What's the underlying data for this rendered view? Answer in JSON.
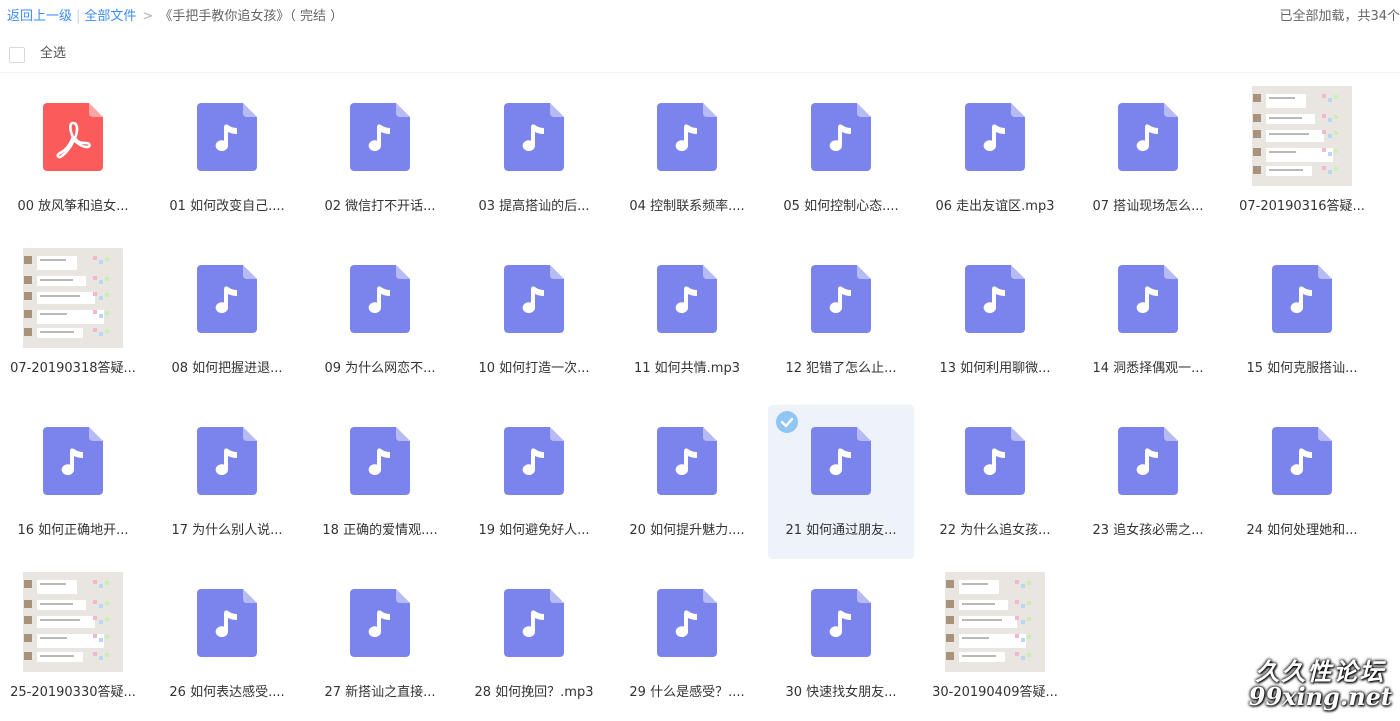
{
  "header": {
    "back_label": "返回上一级",
    "all_files_label": "全部文件",
    "current_folder": "《手把手教你追女孩》（ 完结 ）",
    "loaded_status": "已全部加载，共34个"
  },
  "select_all_label": "全选",
  "colors": {
    "audio_icon": "#7b83ec",
    "pdf_icon": "#fb5b5b",
    "link": "#3b8cff",
    "selected_bg": "#eef3fa"
  },
  "files": [
    {
      "name": "00 放风筝和追女...",
      "type": "pdf"
    },
    {
      "name": "01 如何改变自己....",
      "type": "audio"
    },
    {
      "name": "02 微信打不开话...",
      "type": "audio"
    },
    {
      "name": "03 提高搭讪的后...",
      "type": "audio"
    },
    {
      "name": "04 控制联系频率....",
      "type": "audio"
    },
    {
      "name": "05 如何控制心态....",
      "type": "audio"
    },
    {
      "name": "06 走出友谊区.mp3",
      "type": "audio"
    },
    {
      "name": "07 搭讪现场怎么...",
      "type": "audio"
    },
    {
      "name": "07-20190316答疑...",
      "type": "image"
    },
    {
      "name": "07-20190318答疑...",
      "type": "image"
    },
    {
      "name": "08 如何把握进退...",
      "type": "audio"
    },
    {
      "name": "09 为什么网恋不...",
      "type": "audio"
    },
    {
      "name": "10 如何打造一次...",
      "type": "audio"
    },
    {
      "name": "11 如何共情.mp3",
      "type": "audio"
    },
    {
      "name": "12 犯错了怎么止...",
      "type": "audio"
    },
    {
      "name": "13 如何利用聊微...",
      "type": "audio"
    },
    {
      "name": "14 洞悉择偶观一...",
      "type": "audio"
    },
    {
      "name": "15 如何克服搭讪...",
      "type": "audio"
    },
    {
      "name": "16 如何正确地开...",
      "type": "audio"
    },
    {
      "name": "17 为什么别人说...",
      "type": "audio"
    },
    {
      "name": "18 正确的爱情观....",
      "type": "audio"
    },
    {
      "name": "19 如何避免好人...",
      "type": "audio"
    },
    {
      "name": "20 如何提升魅力....",
      "type": "audio"
    },
    {
      "name": "21 如何通过朋友...",
      "type": "audio",
      "selected": true
    },
    {
      "name": "22 为什么追女孩...",
      "type": "audio"
    },
    {
      "name": "23 追女孩必需之...",
      "type": "audio"
    },
    {
      "name": "24 如何处理她和...",
      "type": "audio"
    },
    {
      "name": "25-20190330答疑...",
      "type": "image"
    },
    {
      "name": "26 如何表达感受....",
      "type": "audio"
    },
    {
      "name": "27 新搭讪之直接...",
      "type": "audio"
    },
    {
      "name": "28 如何挽回？.mp3",
      "type": "audio"
    },
    {
      "name": "29 什么是感受？....",
      "type": "audio"
    },
    {
      "name": "30 快速找女朋友...",
      "type": "audio"
    },
    {
      "name": "30-20190409答疑...",
      "type": "image"
    }
  ],
  "watermark": {
    "line1": "久久性论坛",
    "line2": "99xing.net"
  }
}
